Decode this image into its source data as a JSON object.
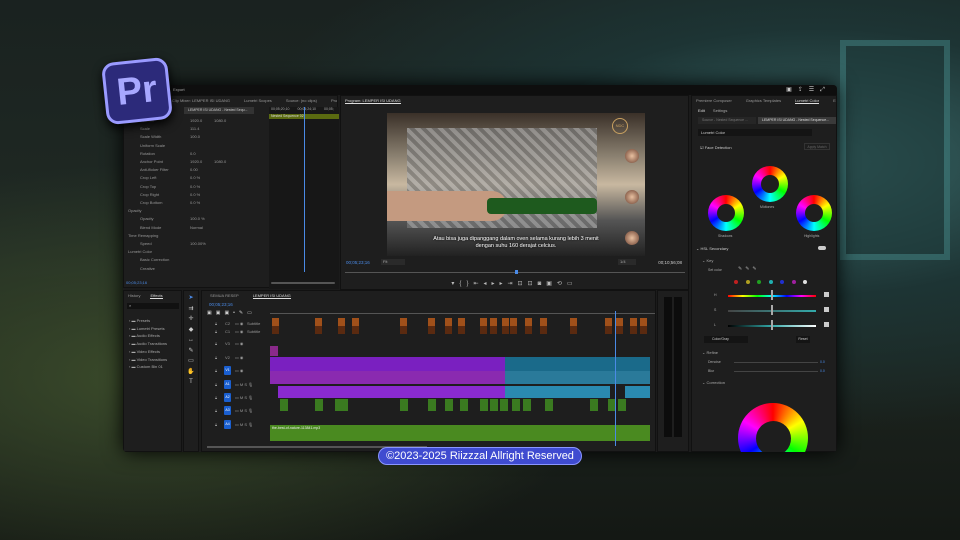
{
  "app": {
    "logo": "Pr",
    "menu": "Export",
    "copyright": "©2023-2025 Riizzzal Allright Reserved"
  },
  "effect_controls": {
    "tabs": [
      "Clip Mixer: LEMPER ISI UDANG",
      "Lumetri Scopes",
      "Source: (no clips)",
      "Project: L"
    ],
    "source": "LEMPER ISI UDANG - Nested Sequ...",
    "timecodes": [
      "00;05;20;10",
      "00;05;24;10",
      "00;05;"
    ],
    "nested": "Nested Sequence 02",
    "rows": [
      {
        "label": "Position",
        "v1": "1920.0",
        "v2": "1080.0"
      },
      {
        "label": "Scale",
        "v1": "111.4"
      },
      {
        "label": "Scale Width",
        "v1": "100.0"
      },
      {
        "label": "Uniform Scale"
      },
      {
        "label": "Rotation",
        "v1": "0.0"
      },
      {
        "label": "Anchor Point",
        "v1": "1920.0",
        "v2": "1080.0"
      },
      {
        "label": "Anti-flicker Filter",
        "v1": "0.00"
      },
      {
        "label": "Crop Left",
        "v1": "0.0 %"
      },
      {
        "label": "Crop Top",
        "v1": "0.0 %"
      },
      {
        "label": "Crop Right",
        "v1": "0.0 %"
      },
      {
        "label": "Crop Bottom",
        "v1": "0.0 %"
      },
      {
        "label": "Opacity"
      },
      {
        "label": "Opacity",
        "v1": "100.0 %"
      },
      {
        "label": "Blend Mode",
        "v1": "Normal"
      },
      {
        "label": "Time Remapping"
      },
      {
        "label": "Speed",
        "v1": "100.00%"
      },
      {
        "label": "Lumetri Color"
      },
      {
        "label": "Basic Correction"
      },
      {
        "label": "Creative"
      }
    ],
    "timecode": "00;05;23;16"
  },
  "program": {
    "title": "Program: LEMPER ISI UDANG",
    "subtitle_line1": "Atau bisa juga dipanggang dalam oven selama kurang lebih 3 menit",
    "subtitle_line2": "dengan suhu 160 derajat celcius.",
    "brand": "NDC",
    "timecode": "00;05;23;16",
    "fit": "Fit",
    "quality": "1/4",
    "duration": "00;10;56;08",
    "playhead_fraction": 0.5
  },
  "lumetri": {
    "tabs": [
      "Premiere Composer",
      "Graphics Templates",
      "Lumetri Color",
      "Essent"
    ],
    "subtabs": [
      "Edit",
      "Settings"
    ],
    "source_master": "Source - Nested Sequence ...",
    "source_clip": "LEMPER ISI UDANG - Nested Sequence...",
    "effect": "Lumetri Color",
    "face_detection": "Face Detection",
    "apply_match": "Apply Match",
    "wheels": [
      "Midtones",
      "Shadows",
      "Highlights"
    ],
    "hsl": "HSL Secondary",
    "key": "Key",
    "set_color": "Set color",
    "hsl_labels": [
      "H",
      "S",
      "L"
    ],
    "color_gray": "Color/Gray",
    "reset": "Reset",
    "refine": "Refine",
    "denoise": "Denoise",
    "denoise_val": "0.0",
    "blur": "Blur",
    "blur_val": "0.0",
    "correction": "Correction",
    "swatches": [
      "#c02020",
      "#b0a020",
      "#20a020",
      "#20b0b0",
      "#2030d0",
      "#a020a0",
      "#e0e0e0"
    ]
  },
  "effects_panel": {
    "tabs": [
      "History",
      "Effects"
    ],
    "items": [
      "Presets",
      "Lumetri Presets",
      "Audio Effects",
      "Audio Transitions",
      "Video Effects",
      "Video Transitions",
      "Custom Bin 01"
    ]
  },
  "timeline": {
    "tabs": [
      "SEMUA RESEP",
      "LEMPER ISI UDANG"
    ],
    "timecode": "00;05;23;16",
    "tracks": [
      {
        "id": "C2",
        "name": "Subtitle"
      },
      {
        "id": "C1",
        "name": "Subtitle"
      },
      {
        "id": "V3"
      },
      {
        "id": "V2"
      },
      {
        "id": "V1"
      },
      {
        "id": "A1"
      },
      {
        "id": "A2"
      },
      {
        "id": "A3"
      },
      {
        "id": "A4"
      }
    ],
    "audio_clip": "the-best-of-nature-113841.mp3",
    "zoom": "0.0"
  }
}
